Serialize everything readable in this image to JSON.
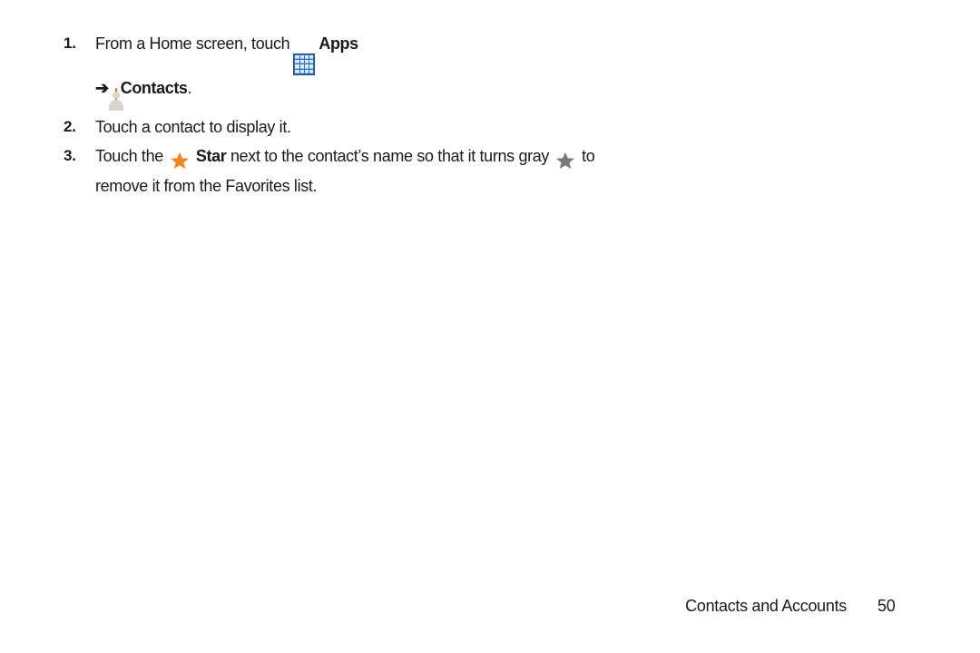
{
  "page": {
    "background_color": "#ffffff",
    "text_color": "#1a1a1a"
  },
  "steps": [
    {
      "number": "1.",
      "segments": [
        {
          "type": "text",
          "value": "From a Home screen, touch "
        },
        {
          "type": "icon",
          "icon": "apps-grid-icon"
        },
        {
          "type": "bold",
          "value": "Apps"
        },
        {
          "type": "break"
        },
        {
          "type": "arrow",
          "value": "➔"
        },
        {
          "type": "icon",
          "icon": "contacts-person-icon"
        },
        {
          "type": "bold",
          "value": "Contacts"
        },
        {
          "type": "text",
          "value": "."
        }
      ],
      "plain_text": "From a Home screen, touch Apps ➔ Contacts."
    },
    {
      "number": "2.",
      "segments": [
        {
          "type": "text",
          "value": "Touch a contact to display it."
        }
      ],
      "plain_text": "Touch a contact to display it."
    },
    {
      "number": "3.",
      "segments": [
        {
          "type": "text",
          "value": "Touch the "
        },
        {
          "type": "icon",
          "icon": "star-orange-icon"
        },
        {
          "type": "bold",
          "value": "Star"
        },
        {
          "type": "text",
          "value": " next to the contact’s name so that it turns gray "
        },
        {
          "type": "icon",
          "icon": "star-gray-icon"
        },
        {
          "type": "text",
          "value": " to remove it from the Favorites list."
        }
      ],
      "plain_text": "Touch the Star next to the contact’s name so that it turns gray to remove it from the Favorites list."
    }
  ],
  "step_text": {
    "step1_line1_pre": "From a Home screen, touch",
    "step1_apps_label": "Apps",
    "step1_arrow": "➔",
    "step1_contacts_label": "Contacts",
    "step1_period": ".",
    "step2": "Touch a contact to display it.",
    "step3_pre": "Touch the",
    "step3_star_label": "Star",
    "step3_mid": "next to the contact’s name so that it",
    "step3_line2_pre": "turns gray",
    "step3_line2_post": "to remove it from the Favorites list."
  },
  "step_numbers": {
    "one": "1.",
    "two": "2.",
    "three": "3."
  },
  "icons": {
    "apps": {
      "name": "apps-grid-icon",
      "background_color": "#2a6fc0",
      "border_color": "#1d4f8f",
      "cell_color": "#dcebfa",
      "rows": 4,
      "columns": 4
    },
    "contacts": {
      "name": "contacts-person-icon",
      "background_color": "#ef7f12",
      "silhouette_color": "#d7d3cd"
    },
    "star_orange": {
      "name": "star-orange-icon",
      "color": "#f0861f"
    },
    "star_gray": {
      "name": "star-gray-icon",
      "color": "#77787a"
    }
  },
  "footer": {
    "chapter": "Contacts and Accounts",
    "page_number": "50"
  }
}
